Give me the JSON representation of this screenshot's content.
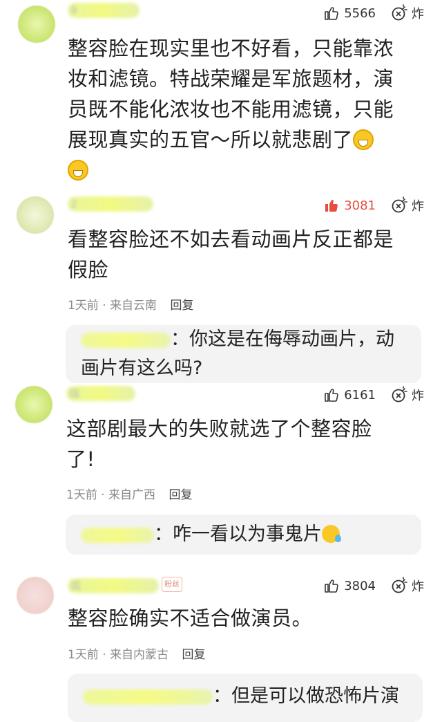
{
  "comments": [
    {
      "user_name_visible": "9",
      "likes": "5566",
      "bomb_label": "炸",
      "text_lines": [
        "整容脸在现实里也不好看，只能靠浓",
        "妆和滤镜。特战荣耀是军旅题材，演",
        "员既不能化浓妆也不能用滤镜，只能",
        "展现真实的五官～所以就悲剧了"
      ]
    },
    {
      "user_name_visible": "2",
      "likes": "3081",
      "liked": true,
      "bomb_label": "炸",
      "text_lines": [
        "看整容脸还不如去看动画片反正都是",
        "假脸"
      ],
      "time": "1天前",
      "location": "来自云南",
      "reply_label": "回复",
      "reply": {
        "text_lines": [
          "：你这是在侮辱动画片，动",
          "画片有这么吗?"
        ]
      }
    },
    {
      "user_name_visible": "瑞",
      "likes": "6161",
      "bomb_label": "炸",
      "text_lines": [
        "这部剧最大的失败就选了个整容脸",
        "了!"
      ],
      "time": "1天前",
      "location": "来自广西",
      "reply_label": "回复",
      "reply": {
        "text_lines": [
          "：咋一看以为事鬼片"
        ]
      }
    },
    {
      "user_name_visible": "孤",
      "tag": "粉丝",
      "likes": "3804",
      "bomb_label": "炸",
      "text_lines": [
        "整容脸确实不适合做演员。"
      ],
      "time": "1天前",
      "location": "来自内蒙古",
      "reply_label": "回复",
      "reply": {
        "text_lines": [
          "：但是可以做恐怖片演"
        ]
      }
    }
  ],
  "colors": {
    "liked": "#e74c3c",
    "text": "#222222",
    "meta": "#8a8a8a",
    "reply_bg": "#f3f3f3"
  }
}
